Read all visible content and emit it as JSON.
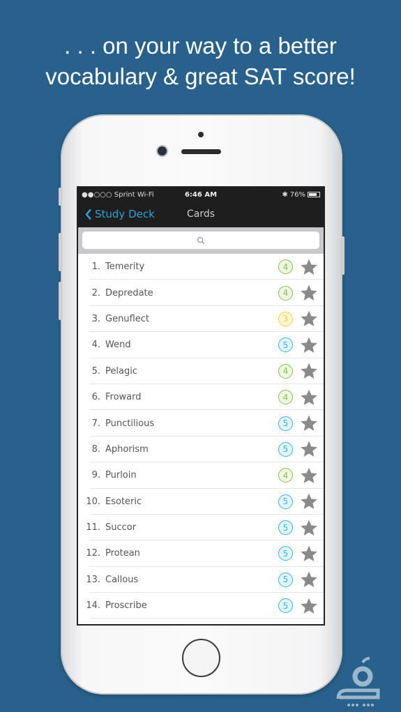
{
  "headline": {
    "line1": ". . . on your way to a better",
    "line2": "vocabulary & great SAT score!"
  },
  "status_bar": {
    "carrier": "●●○○○ Sprint Wi-Fi",
    "time": "6:46 AM",
    "battery": "76%"
  },
  "nav": {
    "back_label": "Study Deck",
    "title": "Cards"
  },
  "search": {
    "placeholder": "",
    "icon": "search-icon"
  },
  "colors": {
    "background": "#28618b",
    "accent": "#2aa3dd",
    "badge_4": "#8cc152",
    "badge_3": "#f5d23c",
    "badge_5": "#35b5e5",
    "star": "#8a8a8a"
  },
  "cards": [
    {
      "num": "1.",
      "word": "Temerity",
      "level": "4"
    },
    {
      "num": "2.",
      "word": "Depredate",
      "level": "4"
    },
    {
      "num": "3.",
      "word": "Genuflect",
      "level": "3"
    },
    {
      "num": "4.",
      "word": "Wend",
      "level": "5"
    },
    {
      "num": "5.",
      "word": "Pelagic",
      "level": "4"
    },
    {
      "num": "6.",
      "word": "Froward",
      "level": "4"
    },
    {
      "num": "7.",
      "word": "Punctilious",
      "level": "5"
    },
    {
      "num": "8.",
      "word": "Aphorism",
      "level": "5"
    },
    {
      "num": "9.",
      "word": "Purloin",
      "level": "4"
    },
    {
      "num": "10.",
      "word": "Esoteric",
      "level": "5"
    },
    {
      "num": "11.",
      "word": "Succor",
      "level": "5"
    },
    {
      "num": "12.",
      "word": "Protean",
      "level": "5"
    },
    {
      "num": "13.",
      "word": "Callous",
      "level": "5"
    },
    {
      "num": "14.",
      "word": "Proscribe",
      "level": "5"
    }
  ]
}
